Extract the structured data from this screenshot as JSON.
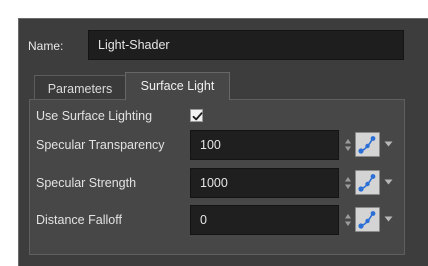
{
  "name": {
    "label": "Name:",
    "value": "Light-Shader"
  },
  "tabs": [
    {
      "label": "Parameters",
      "active": false
    },
    {
      "label": "Surface Light",
      "active": true
    }
  ],
  "surface_light": {
    "use_surface_lighting": {
      "label": "Use Surface Lighting",
      "checked": true
    },
    "specular_transparency": {
      "label": "Specular Transparency",
      "value": "100"
    },
    "specular_strength": {
      "label": "Specular Strength",
      "value": "1000"
    },
    "distance_falloff": {
      "label": "Distance Falloff",
      "value": "0"
    }
  },
  "icons": {
    "stepper": "up-down-stepper-icon",
    "function": "function-curve-icon",
    "dropdown": "chevron-down-icon"
  },
  "colors": {
    "panel_bg": "#3d3d3d",
    "field_bg": "#1f1f1f",
    "tab_active_bg": "#474747",
    "text": "#e2e2e2",
    "accent_blue": "#2b6fd6"
  }
}
